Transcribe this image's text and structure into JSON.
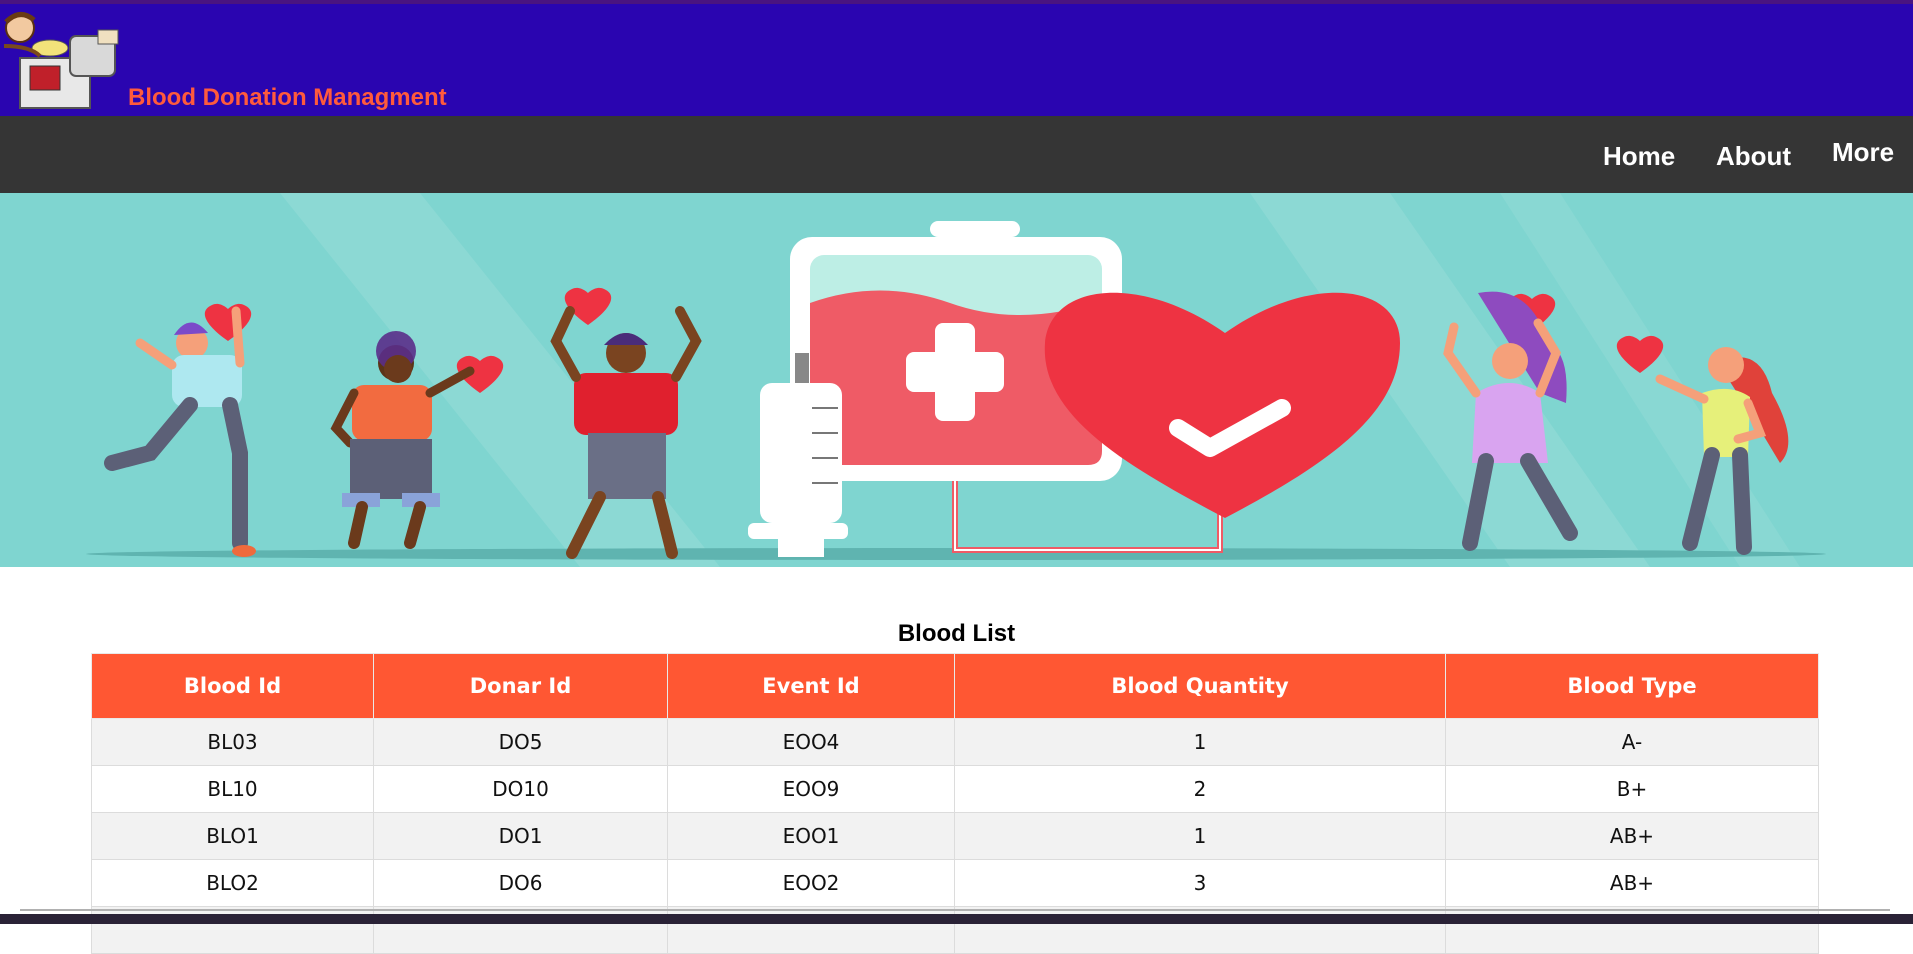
{
  "header": {
    "title": "Blood Donation Managment"
  },
  "nav": {
    "items": [
      "Home",
      "About",
      "More"
    ]
  },
  "table": {
    "title": "Blood List",
    "columns": [
      "Blood Id",
      "Donar Id",
      "Event Id",
      "Blood Quantity",
      "Blood Type"
    ],
    "rows": [
      [
        "BL03",
        "DO5",
        "EOO4",
        "1",
        "A-"
      ],
      [
        "BL10",
        "DO10",
        "EOO9",
        "2",
        "B+"
      ],
      [
        "BLO1",
        "DO1",
        "EOO1",
        "1",
        "AB+"
      ],
      [
        "BLO2",
        "DO6",
        "EOO2",
        "3",
        "AB+"
      ],
      [
        "",
        "",
        "",
        "",
        ""
      ]
    ]
  },
  "colors": {
    "header_bg": "#2a05b0",
    "title_color": "#ff5a3c",
    "nav_bg": "#353535",
    "table_header_bg": "#ff5733",
    "banner_bg": "#7fd5d0"
  }
}
